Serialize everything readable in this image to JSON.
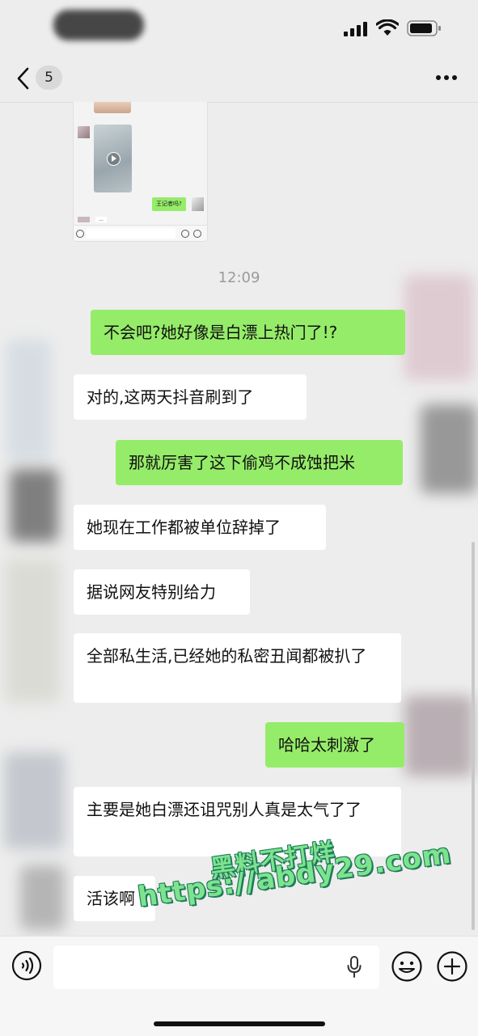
{
  "status_bar": {
    "carrier_name_blurred": true
  },
  "nav": {
    "back_count": "5"
  },
  "shared_screenshot": {
    "message": "王记者吗?",
    "dots": "..."
  },
  "chat": {
    "timestamp": "12:09",
    "messages": [
      {
        "side": "out",
        "text": "不会吧?她好像是白漂上热门了!?"
      },
      {
        "side": "in",
        "text": "对的,这两天抖音刷到了"
      },
      {
        "side": "out",
        "text": "那就厉害了这下偷鸡不成蚀把米"
      },
      {
        "side": "in",
        "text": "她现在工作都被单位辞掉了"
      },
      {
        "side": "in",
        "text": "据说网友特别给力"
      },
      {
        "side": "in",
        "text": "全部私生活,已经她的私密丑闻都被扒了"
      },
      {
        "side": "out",
        "text": "哈哈太刺激了"
      },
      {
        "side": "in",
        "text": "主要是她白漂还诅咒别人真是太气了了"
      },
      {
        "side": "in",
        "text": "活该啊"
      }
    ]
  },
  "watermark": {
    "line1": "黑料不打烊",
    "line2": "https://abdy29.com"
  },
  "colors": {
    "outgoing_bubble": "#95ec69",
    "incoming_bubble": "#ffffff",
    "background": "#ededed"
  },
  "icons": {
    "status": [
      "signal-icon",
      "wifi-icon",
      "battery-icon"
    ],
    "nav": [
      "back-chevron-icon",
      "more-icon"
    ],
    "input": [
      "voice-icon",
      "mic-icon",
      "emoji-icon",
      "plus-icon"
    ]
  }
}
